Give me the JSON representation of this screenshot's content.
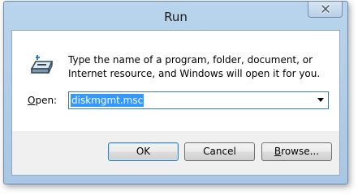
{
  "window": {
    "title": "Run",
    "close_glyph": "close-icon"
  },
  "dialog": {
    "icon": "run-icon",
    "description": "Type the name of a program, folder, document, or Internet resource, and Windows will open it for you.",
    "open_label_access_key": "O",
    "open_label_rest": "pen:",
    "open_value": "diskmgmt.msc",
    "dropdown_icon": "chevron-down-icon"
  },
  "buttons": {
    "ok_label": "OK",
    "cancel_label": "Cancel",
    "browse_access_key": "B",
    "browse_rest": "rowse..."
  }
}
